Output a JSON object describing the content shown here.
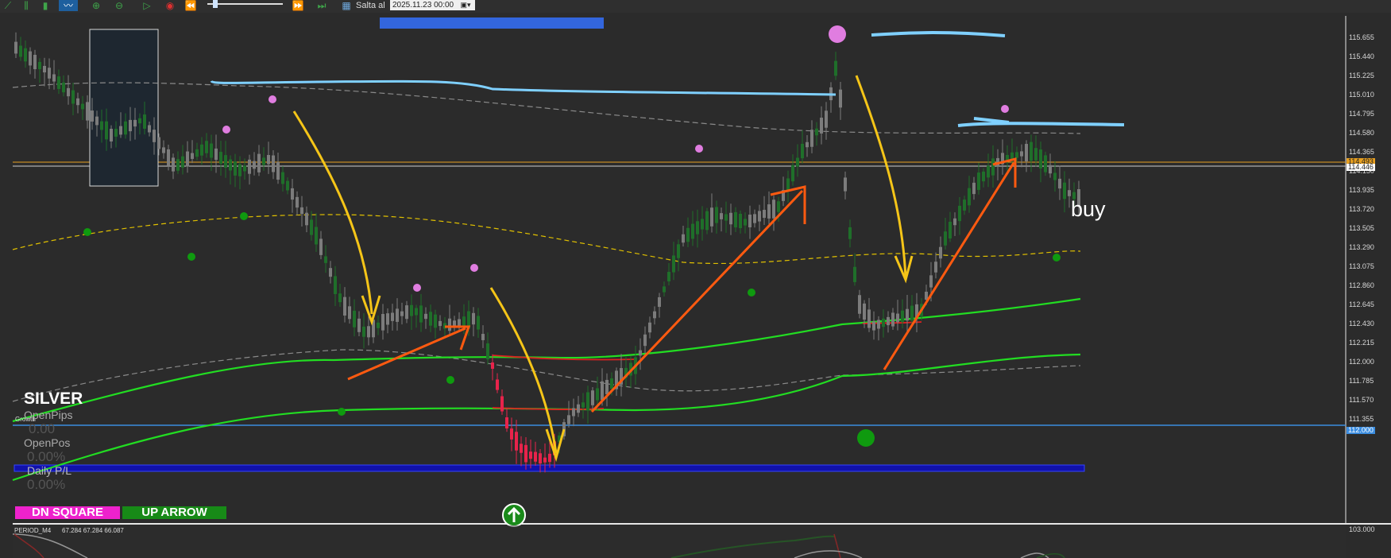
{
  "toolbar": {
    "icons": [
      "chart-type-icon",
      "bar-chart-icon",
      "line-chart-icon",
      "zoom-in-icon",
      "zoom-out-icon",
      "play-icon",
      "stop-icon",
      "rewind-icon",
      "slider",
      "step-forward-icon",
      "step-back-icon",
      "calendar-icon"
    ],
    "goto_label": "Salta al",
    "goto_value": "2025.11.23 00:00"
  },
  "price_axis": {
    "labels": [
      "115.655",
      "115.440",
      "115.225",
      "115.010",
      "114.795",
      "114.580",
      "114.365",
      "114.150",
      "113.935",
      "113.720",
      "113.505",
      "113.290",
      "113.075",
      "112.860",
      "112.645",
      "112.430",
      "112.215",
      "112.000",
      "111.785",
      "111.570",
      "111.355"
    ],
    "current_bid": "114.446",
    "current_ask": "114.493",
    "level_tag": "112.000"
  },
  "indicator_panel": {
    "label": "PERIOD_M4",
    "values": "67.284 67.284 66.087",
    "max_label": "103.000"
  },
  "info_panel": {
    "symbol": "SILVER",
    "growth_label": "Growth",
    "growth_value": "0.00",
    "open_pips_label": "OpenPips",
    "open_pips_value": "0.00",
    "open_pos_label": "OpenPos",
    "open_pos_value": "0.00%",
    "daily_pl_label": "Daily P/L",
    "daily_pl_value": "0.00%"
  },
  "buttons": {
    "dn_square": "DN SQUARE",
    "up_arrow": "UP ARROW"
  },
  "annotation_text": "buy",
  "colors": {
    "background": "#2b2b2b",
    "bull_candle": "#1f6f2a",
    "bear_candle": "#8a8a8a",
    "red_candle": "#e8234b",
    "green_ma": "#22dd22",
    "yellow_band": "#e0c000",
    "orange_arrow": "#ff5a10",
    "yellow_arrow": "#f5c518",
    "cyan_line": "#7fd0ff",
    "signal_magenta": "#e07de0",
    "signal_green": "#0f9a0f"
  }
}
